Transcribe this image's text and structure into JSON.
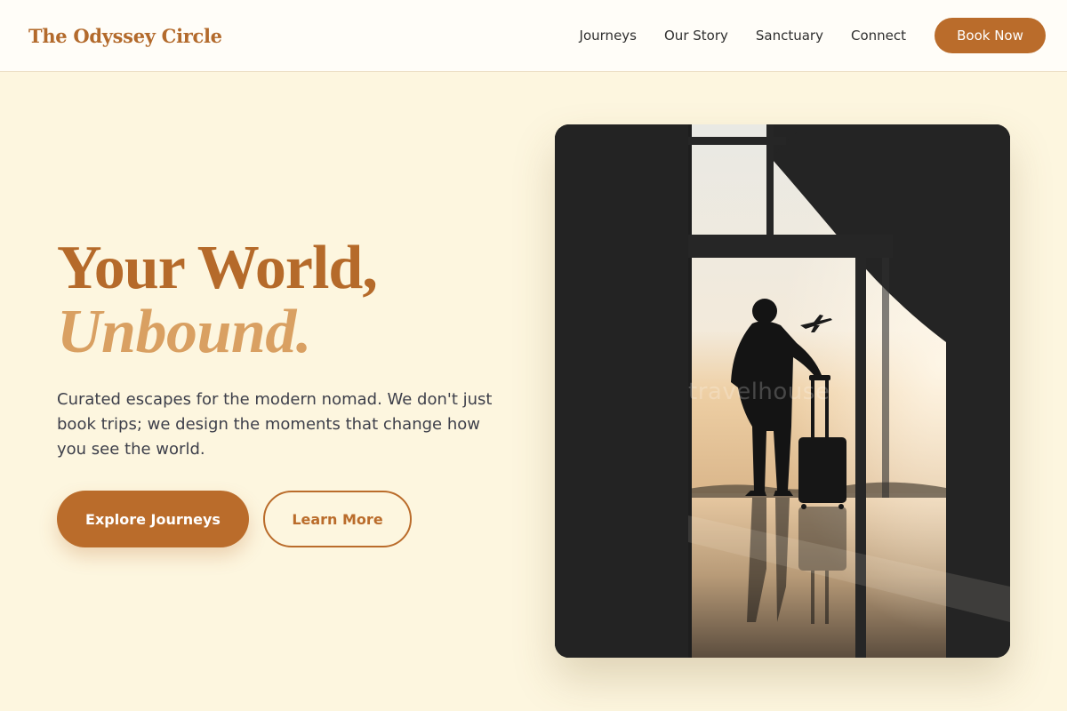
{
  "header": {
    "brand": "The Odyssey Circle",
    "nav": [
      "Journeys",
      "Our Story",
      "Sanctuary",
      "Connect"
    ],
    "cta_label": "Book Now"
  },
  "hero": {
    "title_line1": "Your World,",
    "title_line2": "Unbound.",
    "subtitle": "Curated escapes for the modern nomad. We don't just book trips; we design the moments that change how you see the world.",
    "primary_label": "Explore Journeys",
    "secondary_label": "Learn More"
  },
  "image": {
    "watermark": "travelhouse"
  },
  "colors": {
    "accent": "#BA6C2B",
    "accent_light": "#D9A062",
    "background": "#FDF6DF"
  }
}
